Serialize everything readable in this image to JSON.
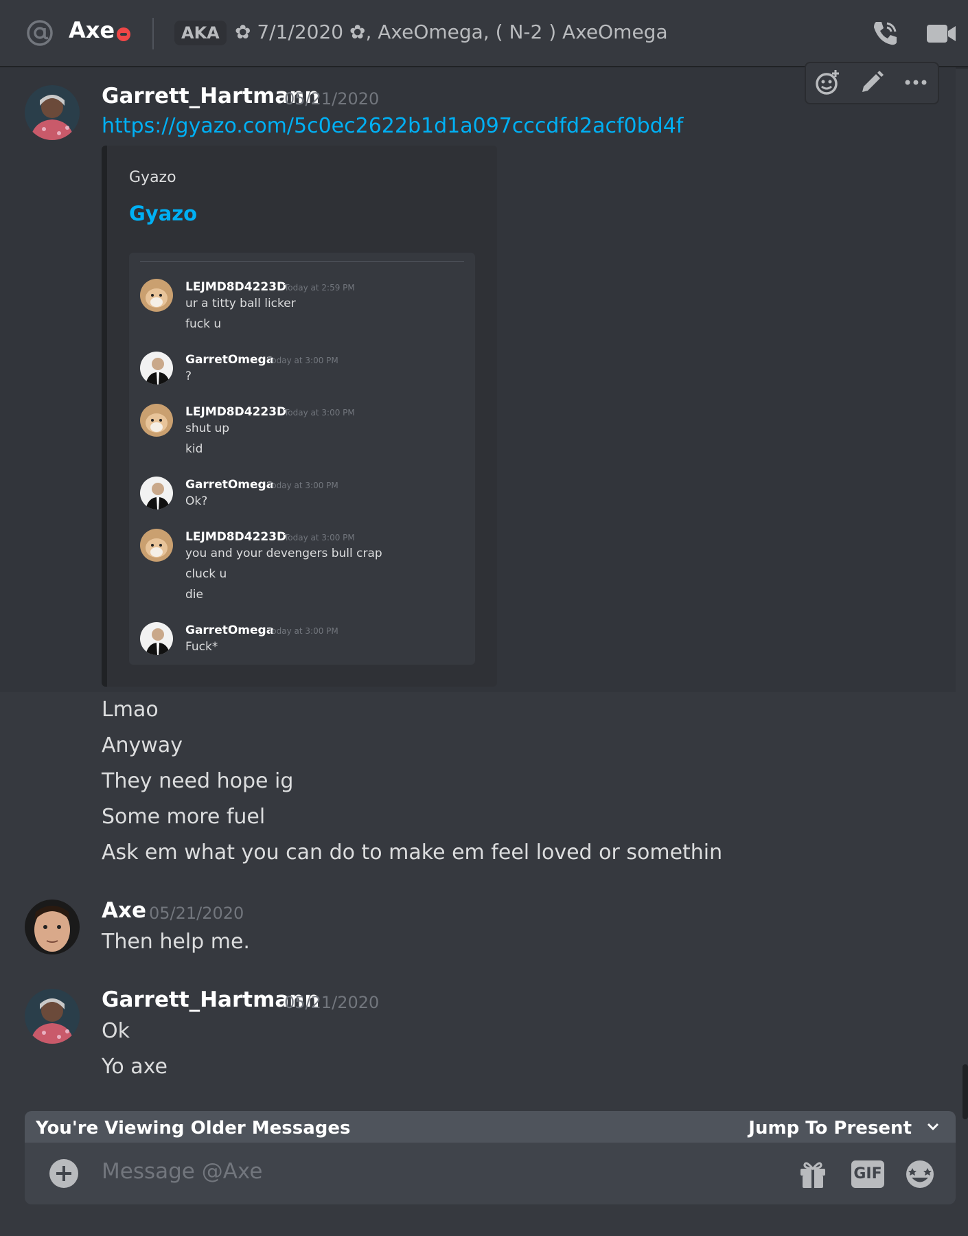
{
  "header": {
    "name": "Axe",
    "aka_label": "AKA",
    "status_text": "✿ 7/1/2020 ✿, AxeOmega, ( N-2 ) AxeOmega"
  },
  "colors": {
    "background": "#36393f",
    "link": "#00b0f4",
    "dnd": "#f04747"
  },
  "messages": [
    {
      "author": "Garrett_Hartmann",
      "timestamp": "05/21/2020",
      "link": "https://gyazo.com/5c0ec2622b1d1a097cccdfd2acf0bd4f",
      "embed": {
        "provider": "Gyazo",
        "title": "Gyazo",
        "screenshot": [
          {
            "author": "LEJMD8D4223D",
            "time": "Today at 2:59 PM",
            "lines": [
              "ur a titty ball licker",
              "fuck u"
            ]
          },
          {
            "author": "GarretOmega",
            "time": "Today at 3:00 PM",
            "lines": [
              "?"
            ]
          },
          {
            "author": "LEJMD8D4223D",
            "time": "Today at 3:00 PM",
            "lines": [
              "shut up",
              "kid"
            ]
          },
          {
            "author": "GarretOmega",
            "time": "Today at 3:00 PM",
            "lines": [
              "Ok?"
            ]
          },
          {
            "author": "LEJMD8D4223D",
            "time": "Today at 3:00 PM",
            "lines": [
              "you and your devengers bull crap",
              "cluck u",
              "die"
            ]
          },
          {
            "author": "GarretOmega",
            "time": "Today at 3:00 PM",
            "lines": [
              "Fuck*"
            ]
          }
        ]
      },
      "followups": [
        "Lmao",
        "Anyway",
        "They need hope ig",
        "Some more fuel",
        "Ask em what you can do to make em feel loved or somethin"
      ]
    },
    {
      "author": "Axe",
      "timestamp": "05/21/2020",
      "lines": [
        "Then help me."
      ]
    },
    {
      "author": "Garrett_Hartmann",
      "timestamp": "05/21/2020",
      "lines": [
        "Ok",
        "Yo axe"
      ]
    }
  ],
  "older_bar": {
    "text": "You're Viewing Older Messages",
    "jump": "Jump To Present"
  },
  "composer": {
    "placeholder": "Message @Axe",
    "gif_label": "GIF"
  },
  "icons": [
    "at-icon",
    "dnd-status-icon",
    "call-icon",
    "video-icon",
    "add-reaction-icon",
    "edit-icon",
    "more-icon",
    "chevron-down-icon",
    "plus-icon",
    "gift-icon",
    "emoji-icon"
  ]
}
